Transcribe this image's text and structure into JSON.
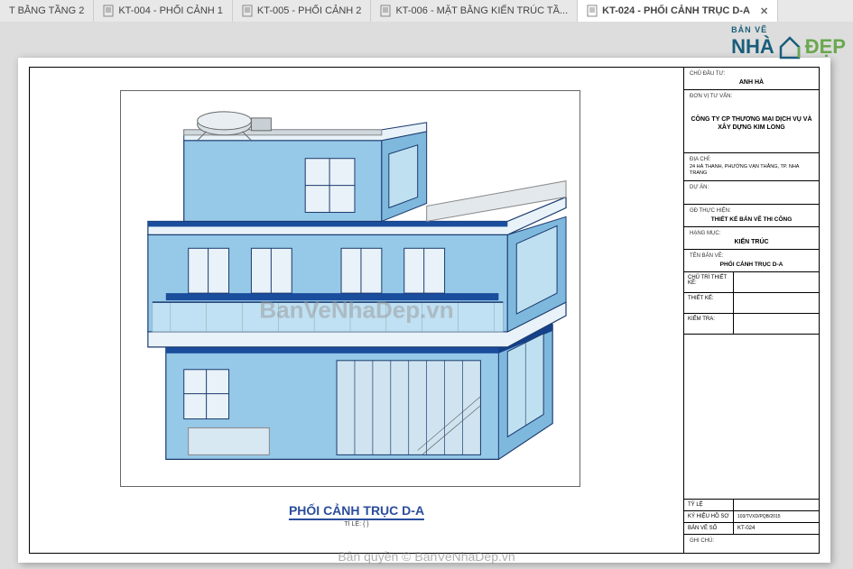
{
  "tabs": [
    {
      "label": "T BẰNG TẦNG 2",
      "active": false,
      "truncated_left": true
    },
    {
      "label": "KT-004 - PHỐI CẢNH 1",
      "active": false
    },
    {
      "label": "KT-005 - PHỐI CẢNH 2",
      "active": false
    },
    {
      "label": "KT-006 - MẶT BẰNG KIẾN TRÚC TẦ...",
      "active": false
    },
    {
      "label": "KT-024 - PHỐI CẢNH TRỤC D-A",
      "active": true,
      "closable": true
    }
  ],
  "logo": {
    "line1": "BẢN VẼ",
    "line2_a": "NHÀ",
    "line2_b": "ĐẸP"
  },
  "drawing": {
    "title": "PHỐI CẢNH TRỤC D-A",
    "scale_label": "TỈ LỆ: { }"
  },
  "titleblock": {
    "owner_label": "CHỦ ĐẦU TƯ:",
    "owner": "ANH HÀ",
    "consultant_label": "ĐƠN VỊ TƯ VẤN:",
    "consultant": "CÔNG TY CP THƯƠNG MẠI DỊCH VỤ VÀ XÂY DỰNG KIM LONG",
    "address_label": "ĐỊA CHỈ:",
    "address": "24 HÀ THANH, PHƯỜNG VẠN THẮNG, TP. NHA TRANG",
    "project_label": "DỰ ÁN:",
    "step_label": "GĐ THỰC HIỆN:",
    "step": "THIẾT KẾ BẢN VẼ THI CÔNG",
    "category_label": "HẠNG MỤC:",
    "category": "KIẾN TRÚC",
    "sheet_name_label": "TÊN BẢN VẼ:",
    "sheet_name": "PHỐI CẢNH TRỤC D-A",
    "chief_label": "CHỦ TRÌ THIẾT KẾ:",
    "designer_label": "THIẾT KẾ:",
    "checker_label": "KIỂM TRA:",
    "rows": {
      "scale_k": "TỶ LỆ",
      "scale_v": "",
      "code_k": "KÝ HIỆU HỒ SƠ",
      "code_v": "103/TVXD/PQB/2015",
      "sheet_k": "BẢN VẼ SỐ",
      "sheet_v": "KT-024",
      "note_k": "GHI CHÚ:"
    }
  },
  "watermark": "BanVeNhaDep.vn",
  "copyright": "Bản quyền © BanVeNhaDep.vn"
}
